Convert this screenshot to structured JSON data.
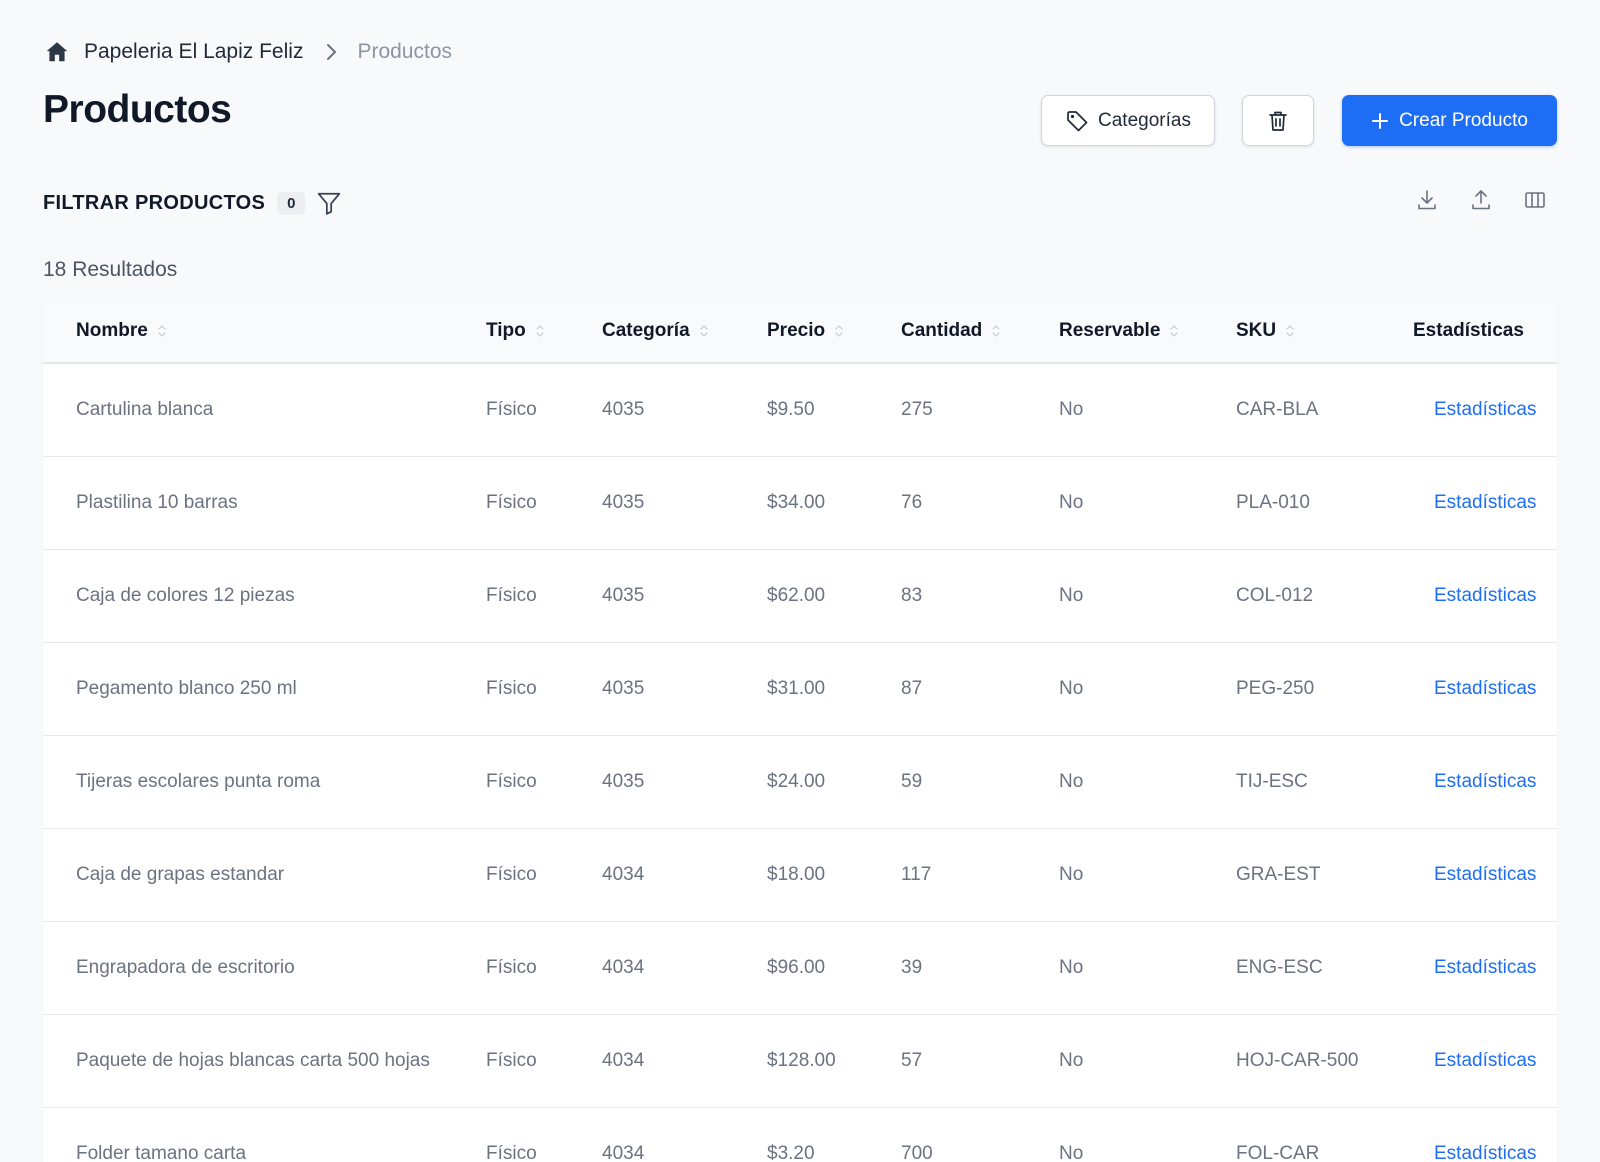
{
  "breadcrumb": {
    "store": "Papeleria El Lapiz Feliz",
    "current": "Productos"
  },
  "page": {
    "title": "Productos"
  },
  "actions": {
    "categories_label": "Categorías",
    "create_label": "Crear Producto"
  },
  "filters": {
    "title": "FILTRAR PRODUCTOS",
    "count": "0"
  },
  "results_text": "18 Resultados",
  "table": {
    "columns": [
      "Nombre",
      "Tipo",
      "Categoría",
      "Precio",
      "Cantidad",
      "Reservable",
      "SKU",
      "Estadísticas"
    ],
    "rows": [
      {
        "nombre": "Cartulina blanca",
        "tipo": "Físico",
        "categoria": "4035",
        "precio": "$9.50",
        "cantidad": "275",
        "reservable": "No",
        "sku": "CAR-BLA",
        "estadisticas": "Estadísticas"
      },
      {
        "nombre": "Plastilina 10 barras",
        "tipo": "Físico",
        "categoria": "4035",
        "precio": "$34.00",
        "cantidad": "76",
        "reservable": "No",
        "sku": "PLA-010",
        "estadisticas": "Estadísticas"
      },
      {
        "nombre": "Caja de colores 12 piezas",
        "tipo": "Físico",
        "categoria": "4035",
        "precio": "$62.00",
        "cantidad": "83",
        "reservable": "No",
        "sku": "COL-012",
        "estadisticas": "Estadísticas"
      },
      {
        "nombre": "Pegamento blanco 250 ml",
        "tipo": "Físico",
        "categoria": "4035",
        "precio": "$31.00",
        "cantidad": "87",
        "reservable": "No",
        "sku": "PEG-250",
        "estadisticas": "Estadísticas"
      },
      {
        "nombre": "Tijeras escolares punta roma",
        "tipo": "Físico",
        "categoria": "4035",
        "precio": "$24.00",
        "cantidad": "59",
        "reservable": "No",
        "sku": "TIJ-ESC",
        "estadisticas": "Estadísticas"
      },
      {
        "nombre": "Caja de grapas estandar",
        "tipo": "Físico",
        "categoria": "4034",
        "precio": "$18.00",
        "cantidad": "117",
        "reservable": "No",
        "sku": "GRA-EST",
        "estadisticas": "Estadísticas"
      },
      {
        "nombre": "Engrapadora de escritorio",
        "tipo": "Físico",
        "categoria": "4034",
        "precio": "$96.00",
        "cantidad": "39",
        "reservable": "No",
        "sku": "ENG-ESC",
        "estadisticas": "Estadísticas"
      },
      {
        "nombre": "Paquete de hojas blancas carta 500 hojas",
        "tipo": "Físico",
        "categoria": "4034",
        "precio": "$128.00",
        "cantidad": "57",
        "reservable": "No",
        "sku": "HOJ-CAR-500",
        "estadisticas": "Estadísticas"
      },
      {
        "nombre": "Folder tamano carta",
        "tipo": "Físico",
        "categoria": "4034",
        "precio": "$3.20",
        "cantidad": "700",
        "reservable": "No",
        "sku": "FOL-CAR",
        "estadisticas": "Estadísticas"
      }
    ]
  },
  "colors": {
    "primary": "#1d6ef5",
    "background": "#f8f9fb",
    "text": "#111827",
    "muted": "#6b7280"
  },
  "icons": [
    "home-icon",
    "chevron-right-icon",
    "tag-icon",
    "trash-icon",
    "plus-icon",
    "filter-icon",
    "download-icon",
    "upload-icon",
    "columns-icon",
    "sort-icon"
  ]
}
